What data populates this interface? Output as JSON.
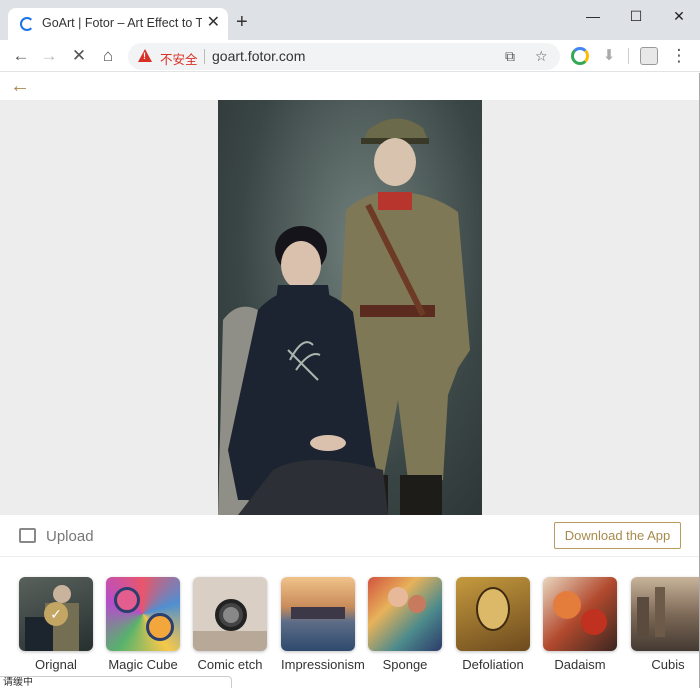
{
  "browser": {
    "tab": {
      "title": "GoArt | Fotor – Art Effect to Tra"
    },
    "new_tab": "+",
    "controls": {
      "minimize": "—",
      "maximize": "☐",
      "close": "✕"
    },
    "nav": {
      "back": "←",
      "forward": "→",
      "reload": "✕",
      "home": "⌂"
    },
    "omnibox": {
      "security_label": "不安全",
      "url": "goart.fotor.com"
    },
    "menu": "⋮"
  },
  "page": {
    "back_arrow": "←",
    "upload_label": "Upload",
    "download_label": "Download the App",
    "effects": [
      {
        "label": "Orignal",
        "selected": true
      },
      {
        "label": "Magic Cube",
        "selected": false
      },
      {
        "label": "Comic etch",
        "selected": false
      },
      {
        "label": "Impressionism",
        "selected": false
      },
      {
        "label": "Sponge",
        "selected": false
      },
      {
        "label": "Defoliation",
        "selected": false
      },
      {
        "label": "Dadaism",
        "selected": false
      },
      {
        "label": "Cubis",
        "selected": false
      }
    ],
    "check_mark": "✓"
  },
  "status": {
    "text": "请缓中"
  },
  "colors": {
    "accent": "#a88a4d",
    "warning": "#d93025"
  }
}
